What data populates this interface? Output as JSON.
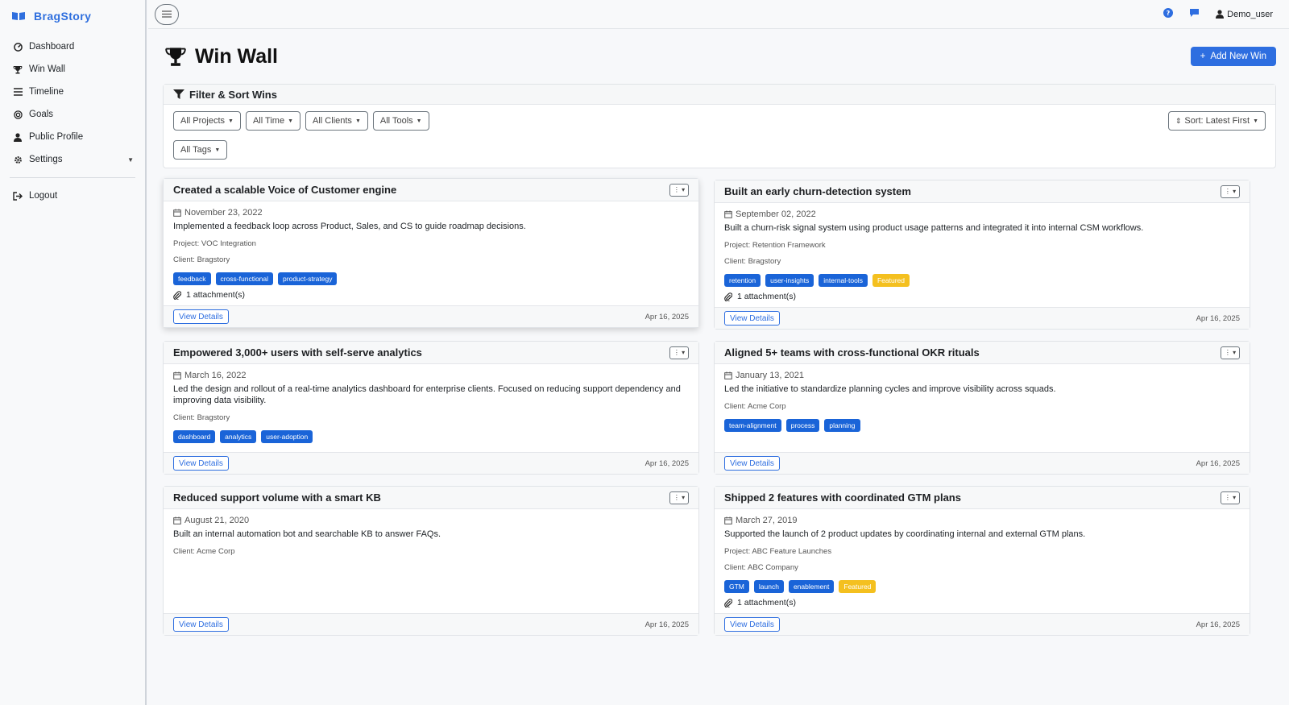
{
  "brand": {
    "name": "BragStory"
  },
  "sidebar": {
    "items": [
      {
        "label": "Dashboard",
        "icon": "dashboard-icon"
      },
      {
        "label": "Win Wall",
        "icon": "trophy-icon"
      },
      {
        "label": "Timeline",
        "icon": "list-icon"
      },
      {
        "label": "Goals",
        "icon": "target-icon"
      },
      {
        "label": "Public Profile",
        "icon": "user-icon"
      },
      {
        "label": "Settings",
        "icon": "gear-icon"
      }
    ],
    "logout": "Logout"
  },
  "topbar": {
    "user": "Demo_user"
  },
  "page": {
    "title": "Win Wall",
    "add_button": "Add New Win"
  },
  "filters": {
    "title": "Filter & Sort Wins",
    "projects": "All Projects",
    "time": "All Time",
    "clients": "All Clients",
    "tools": "All Tools",
    "tags": "All Tags",
    "sort": "Sort: Latest First"
  },
  "cards": [
    {
      "title": "Created a scalable Voice of Customer engine",
      "date": "November 23, 2022",
      "description": "Implemented a feedback loop across Product, Sales, and CS to guide roadmap decisions.",
      "project": "Project: VOC Integration",
      "client": "Client: Bragstory",
      "tags": [
        "feedback",
        "cross-functional",
        "product-strategy"
      ],
      "featured": "",
      "attachments": "1 attachment(s)",
      "view": "View Details",
      "stamp": "Apr 16, 2025"
    },
    {
      "title": "Built an early churn-detection system",
      "date": "September 02, 2022",
      "description": "Built a churn-risk signal system using product usage patterns and integrated it into internal CSM workflows.",
      "project": "Project: Retention Framework",
      "client": "Client: Bragstory",
      "tags": [
        "retention",
        "user-insights",
        "internal-tools"
      ],
      "featured": "Featured",
      "attachments": "1 attachment(s)",
      "view": "View Details",
      "stamp": "Apr 16, 2025"
    },
    {
      "title": "Empowered 3,000+ users with self-serve analytics",
      "date": "March 16, 2022",
      "description": "Led the design and rollout of a real-time analytics dashboard for enterprise clients. Focused on reducing support dependency and improving data visibility.",
      "project": "",
      "client": "Client: Bragstory",
      "tags": [
        "dashboard",
        "analytics",
        "user-adoption"
      ],
      "featured": "",
      "attachments": "",
      "view": "View Details",
      "stamp": "Apr 16, 2025"
    },
    {
      "title": "Aligned 5+ teams with cross-functional OKR rituals",
      "date": "January 13, 2021",
      "description": "Led the initiative to standardize planning cycles and improve visibility across squads.",
      "project": "",
      "client": "Client: Acme Corp",
      "tags": [
        "team-alignment",
        "process",
        "planning"
      ],
      "featured": "",
      "attachments": "",
      "view": "View Details",
      "stamp": "Apr 16, 2025"
    },
    {
      "title": "Reduced support volume with a smart KB",
      "date": "August 21, 2020",
      "description": "Built an internal automation bot and searchable KB to answer FAQs.",
      "project": "",
      "client": "Client: Acme Corp",
      "tags": [],
      "featured": "",
      "attachments": "",
      "view": "View Details",
      "stamp": "Apr 16, 2025"
    },
    {
      "title": "Shipped 2 features with coordinated GTM plans",
      "date": "March 27, 2019",
      "description": "Supported the launch of 2 product updates by coordinating internal and external GTM plans.",
      "project": "Project: ABC Feature Launches",
      "client": "Client: ABC Company",
      "tags": [
        "GTM",
        "launch",
        "enablement"
      ],
      "featured": "Featured",
      "attachments": "1 attachment(s)",
      "view": "View Details",
      "stamp": "Apr 16, 2025"
    }
  ],
  "colors": {
    "primary": "#2e6ee0",
    "tag": "#1a64d8",
    "featured": "#f4c01f",
    "brand": "#2f6fde"
  }
}
